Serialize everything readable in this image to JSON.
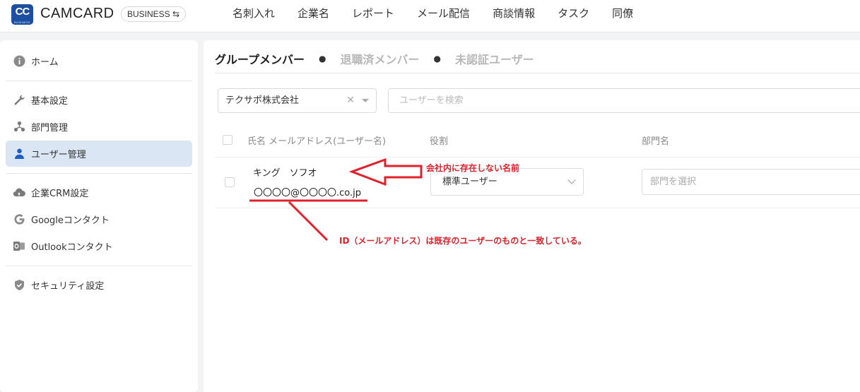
{
  "app": {
    "logo_text": "CC",
    "logo_sub": "BUSINESS",
    "brand": "CAMCARD",
    "edition": "BUSINESS ⇆"
  },
  "nav": [
    "名刺入れ",
    "企業名",
    "レポート",
    "メール配信",
    "商談情報",
    "タスク",
    "同僚"
  ],
  "sidebar": {
    "items": [
      {
        "label": "ホーム",
        "icon": "info-icon"
      },
      {
        "label": "基本設定",
        "icon": "wrench-icon"
      },
      {
        "label": "部門管理",
        "icon": "org-chart-icon"
      },
      {
        "label": "ユーザー管理",
        "icon": "user-icon",
        "active": true
      },
      {
        "label": "企業CRM設定",
        "icon": "cloud-icon"
      },
      {
        "label": "Googleコンタクト",
        "icon": "google-icon"
      },
      {
        "label": "Outlookコンタクト",
        "icon": "outlook-icon"
      },
      {
        "label": "セキュリティ設定",
        "icon": "shield-icon"
      }
    ]
  },
  "tabs": [
    "グループメンバー",
    "退職済メンバー",
    "未認証ユーザー"
  ],
  "filters": {
    "company": "テクサポ株式会社",
    "search_placeholder": "ユーザーを検索"
  },
  "table": {
    "headers": [
      "氏名 メールアドレス(ユーザー名)",
      "役割",
      "部門名"
    ],
    "rows": [
      {
        "name": "キング　ソフオ",
        "email": "〇〇〇〇@〇〇〇〇.co.jp",
        "role": "標準ユーザー",
        "dept_placeholder": "部門を選択"
      }
    ]
  },
  "annotations": {
    "name_note": "会社内に存在しない名前",
    "email_note": "ID（メールアドレス）は既存のユーザーのものと一致している。",
    "color": "#e0202a"
  },
  "colors": {
    "brand": "#1d4fa0",
    "active_bg": "#dbe6f5"
  }
}
